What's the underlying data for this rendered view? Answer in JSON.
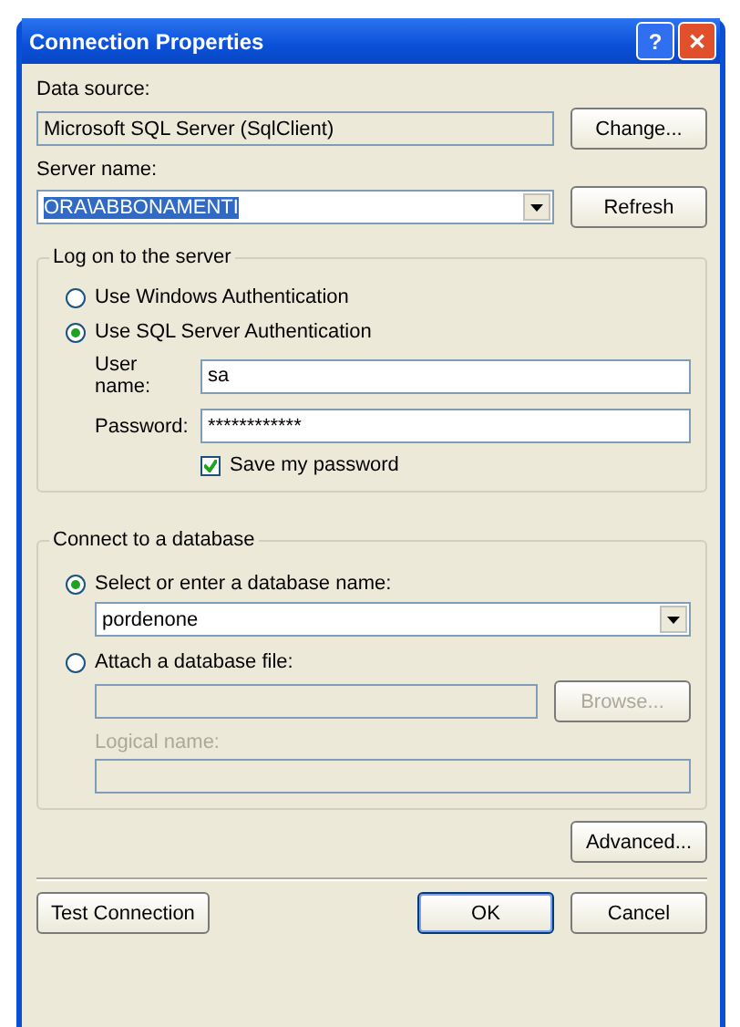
{
  "window": {
    "title": "Connection Properties",
    "help_button": "?",
    "close_button": "✕"
  },
  "data_source": {
    "label": "Data source:",
    "value": "Microsoft SQL Server (SqlClient)",
    "button": "Change..."
  },
  "server_name": {
    "label": "Server name:",
    "value": "ORA\\ABBONAMENTI",
    "selected_text": true,
    "button": "Refresh"
  },
  "log_on": {
    "title": "Log on to the server",
    "options": [
      {
        "label": "Use Windows Authentication",
        "selected": false
      },
      {
        "label": "Use SQL Server Authentication",
        "selected": true
      }
    ],
    "user_name": {
      "label": "User name:",
      "value": "sa"
    },
    "password": {
      "label": "Password:",
      "value": "************"
    },
    "save_password": {
      "label": "Save my password",
      "checked": true
    }
  },
  "connect": {
    "title": "Connect to a database",
    "options": [
      {
        "label": "Select or enter a database name:",
        "selected": true
      },
      {
        "label": "Attach a database file:",
        "selected": false
      }
    ],
    "database_name": {
      "value": "pordenone"
    },
    "file": {
      "button": "Browse...",
      "disabled": true
    },
    "logical_name": {
      "label": "Logical name:",
      "disabled": true
    }
  },
  "advanced_button": "Advanced...",
  "buttons": [
    {
      "label": "Test Connection",
      "default": false
    },
    {
      "label": "OK",
      "default": true
    },
    {
      "label": "Cancel",
      "default": false
    }
  ]
}
